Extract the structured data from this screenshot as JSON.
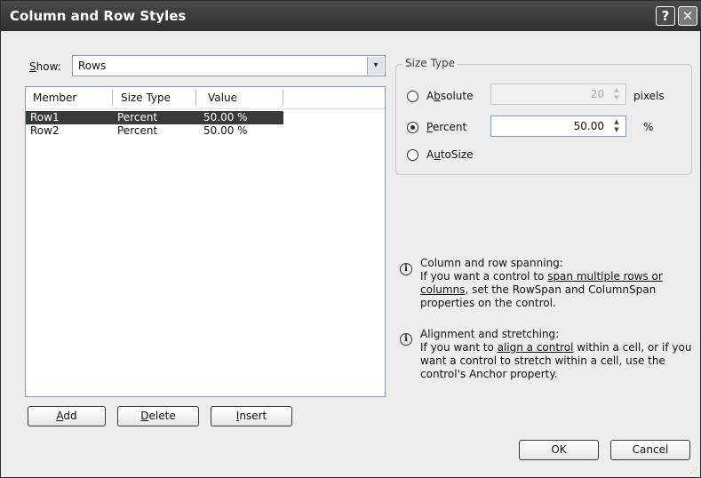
{
  "dialog": {
    "title": "Column and Row Styles",
    "help_glyph": "?",
    "close_glyph": "✕"
  },
  "show": {
    "label_key": "S",
    "label_rest": "how:",
    "value": "Rows",
    "dropdown_glyph": "▾"
  },
  "list": {
    "headers": [
      "Member",
      "Size Type",
      "Value"
    ],
    "rows": [
      {
        "member": "Row1",
        "size_type": "Percent",
        "value": "50.00 %",
        "selected": true
      },
      {
        "member": "Row2",
        "size_type": "Percent",
        "value": "50.00 %",
        "selected": false
      }
    ]
  },
  "buttons": {
    "add": {
      "key": "A",
      "rest": "dd"
    },
    "delete": {
      "key": "D",
      "rest": "elete"
    },
    "insert": {
      "key": "I",
      "rest": "nsert"
    },
    "ok": "OK",
    "cancel": "Cancel"
  },
  "size_type": {
    "group_title": "Size Type",
    "absolute": {
      "pre": "A",
      "key": "b",
      "post": "solute",
      "value": "20",
      "unit": "pixels",
      "checked": false,
      "enabled": false
    },
    "percent": {
      "pre": "",
      "key": "P",
      "post": "ercent",
      "value": "50.00",
      "unit": "%",
      "checked": true,
      "enabled": true
    },
    "autosize": {
      "pre": "A",
      "key": "u",
      "post": "toSize",
      "checked": false
    }
  },
  "info": [
    {
      "heading": "Column and row spanning:",
      "pre": "If you want a control to ",
      "link": "span multiple rows or columns",
      "post": ", set the RowSpan and ColumnSpan properties on the control."
    },
    {
      "heading": "Alignment and stretching:",
      "pre": "If you want to ",
      "link": "align a control",
      "post": " within a cell, or if you want a control to stretch within a cell, use the control's Anchor property."
    }
  ],
  "icons": {
    "info": "info-icon",
    "spin": "spin-arrows-icon",
    "resize_grip": "resize-grip-icon"
  }
}
